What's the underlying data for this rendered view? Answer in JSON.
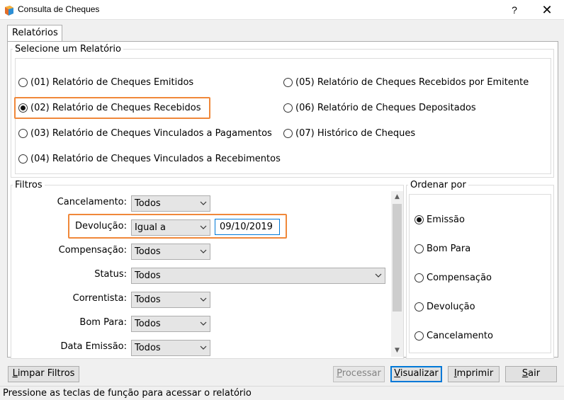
{
  "window": {
    "title": "Consulta de Cheques",
    "help_label": "?",
    "close_label": "✕"
  },
  "tabs": [
    {
      "label": "Relatórios",
      "active": true
    }
  ],
  "reports_group": {
    "legend": "Selecione um Relatório",
    "options": [
      {
        "label": "(01) Relatório de Cheques Emitidos",
        "checked": false
      },
      {
        "label": "(02) Relatório de Cheques Recebidos",
        "checked": true
      },
      {
        "label": "(03) Relatório de Cheques Vinculados a Pagamentos",
        "checked": false
      },
      {
        "label": "(04) Relatório de Cheques Vinculados a Recebimentos",
        "checked": false
      },
      {
        "label": "(05) Relatório de Cheques Recebidos por Emitente",
        "checked": false
      },
      {
        "label": "(06) Relatório de Cheques Depositados",
        "checked": false
      },
      {
        "label": "(07) Histórico de Cheques",
        "checked": false
      }
    ]
  },
  "filters": {
    "legend": "Filtros",
    "rows": [
      {
        "label": "Cancelamento:",
        "value": "Todos"
      },
      {
        "label": "Devolução:",
        "value": "Igual a",
        "date": "09/10/2019"
      },
      {
        "label": "Compensação:",
        "value": "Todos"
      },
      {
        "label": "Status:",
        "value": "Todos"
      },
      {
        "label": "Correntista:",
        "value": "Todos"
      },
      {
        "label": "Bom Para:",
        "value": "Todos"
      },
      {
        "label": "Data Emissão:",
        "value": "Todos"
      }
    ]
  },
  "order_by": {
    "legend": "Ordenar por",
    "options": [
      {
        "label": "Emissão",
        "checked": true
      },
      {
        "label": "Bom Para",
        "checked": false
      },
      {
        "label": "Compensação",
        "checked": false
      },
      {
        "label": "Devolução",
        "checked": false
      },
      {
        "label": "Cancelamento",
        "checked": false
      }
    ]
  },
  "buttons": {
    "clear_filters_key": "L",
    "clear_filters_rest": "impar Filtros",
    "process_key": "P",
    "process_rest": "rocessar",
    "view_key": "V",
    "view_rest": "isualizar",
    "print_key": "I",
    "print_rest": "mprimir",
    "exit_key": "S",
    "exit_rest": "air"
  },
  "status_bar": "Pressione as teclas de função para acessar o relatório",
  "colors": {
    "highlight": "#f0883a",
    "focus": "#0078d7"
  }
}
